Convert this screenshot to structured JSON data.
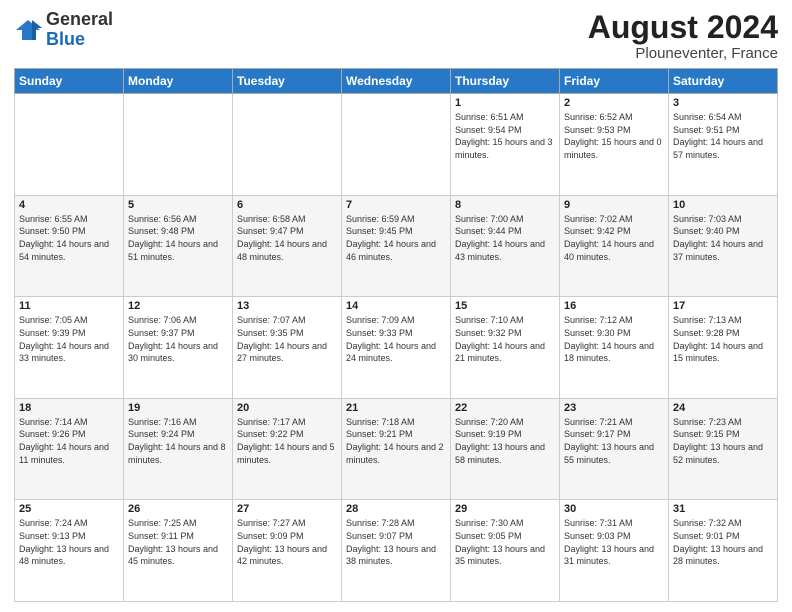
{
  "logo": {
    "general": "General",
    "blue": "Blue"
  },
  "header": {
    "title": "August 2024",
    "subtitle": "Plouneventer, France"
  },
  "weekdays": [
    "Sunday",
    "Monday",
    "Tuesday",
    "Wednesday",
    "Thursday",
    "Friday",
    "Saturday"
  ],
  "weeks": [
    [
      {
        "day": "",
        "sunrise": "",
        "sunset": "",
        "daylight": ""
      },
      {
        "day": "",
        "sunrise": "",
        "sunset": "",
        "daylight": ""
      },
      {
        "day": "",
        "sunrise": "",
        "sunset": "",
        "daylight": ""
      },
      {
        "day": "",
        "sunrise": "",
        "sunset": "",
        "daylight": ""
      },
      {
        "day": "1",
        "sunrise": "6:51 AM",
        "sunset": "9:54 PM",
        "daylight": "15 hours and 3 minutes."
      },
      {
        "day": "2",
        "sunrise": "6:52 AM",
        "sunset": "9:53 PM",
        "daylight": "15 hours and 0 minutes."
      },
      {
        "day": "3",
        "sunrise": "6:54 AM",
        "sunset": "9:51 PM",
        "daylight": "14 hours and 57 minutes."
      }
    ],
    [
      {
        "day": "4",
        "sunrise": "6:55 AM",
        "sunset": "9:50 PM",
        "daylight": "14 hours and 54 minutes."
      },
      {
        "day": "5",
        "sunrise": "6:56 AM",
        "sunset": "9:48 PM",
        "daylight": "14 hours and 51 minutes."
      },
      {
        "day": "6",
        "sunrise": "6:58 AM",
        "sunset": "9:47 PM",
        "daylight": "14 hours and 48 minutes."
      },
      {
        "day": "7",
        "sunrise": "6:59 AM",
        "sunset": "9:45 PM",
        "daylight": "14 hours and 46 minutes."
      },
      {
        "day": "8",
        "sunrise": "7:00 AM",
        "sunset": "9:44 PM",
        "daylight": "14 hours and 43 minutes."
      },
      {
        "day": "9",
        "sunrise": "7:02 AM",
        "sunset": "9:42 PM",
        "daylight": "14 hours and 40 minutes."
      },
      {
        "day": "10",
        "sunrise": "7:03 AM",
        "sunset": "9:40 PM",
        "daylight": "14 hours and 37 minutes."
      }
    ],
    [
      {
        "day": "11",
        "sunrise": "7:05 AM",
        "sunset": "9:39 PM",
        "daylight": "14 hours and 33 minutes."
      },
      {
        "day": "12",
        "sunrise": "7:06 AM",
        "sunset": "9:37 PM",
        "daylight": "14 hours and 30 minutes."
      },
      {
        "day": "13",
        "sunrise": "7:07 AM",
        "sunset": "9:35 PM",
        "daylight": "14 hours and 27 minutes."
      },
      {
        "day": "14",
        "sunrise": "7:09 AM",
        "sunset": "9:33 PM",
        "daylight": "14 hours and 24 minutes."
      },
      {
        "day": "15",
        "sunrise": "7:10 AM",
        "sunset": "9:32 PM",
        "daylight": "14 hours and 21 minutes."
      },
      {
        "day": "16",
        "sunrise": "7:12 AM",
        "sunset": "9:30 PM",
        "daylight": "14 hours and 18 minutes."
      },
      {
        "day": "17",
        "sunrise": "7:13 AM",
        "sunset": "9:28 PM",
        "daylight": "14 hours and 15 minutes."
      }
    ],
    [
      {
        "day": "18",
        "sunrise": "7:14 AM",
        "sunset": "9:26 PM",
        "daylight": "14 hours and 11 minutes."
      },
      {
        "day": "19",
        "sunrise": "7:16 AM",
        "sunset": "9:24 PM",
        "daylight": "14 hours and 8 minutes."
      },
      {
        "day": "20",
        "sunrise": "7:17 AM",
        "sunset": "9:22 PM",
        "daylight": "14 hours and 5 minutes."
      },
      {
        "day": "21",
        "sunrise": "7:18 AM",
        "sunset": "9:21 PM",
        "daylight": "14 hours and 2 minutes."
      },
      {
        "day": "22",
        "sunrise": "7:20 AM",
        "sunset": "9:19 PM",
        "daylight": "13 hours and 58 minutes."
      },
      {
        "day": "23",
        "sunrise": "7:21 AM",
        "sunset": "9:17 PM",
        "daylight": "13 hours and 55 minutes."
      },
      {
        "day": "24",
        "sunrise": "7:23 AM",
        "sunset": "9:15 PM",
        "daylight": "13 hours and 52 minutes."
      }
    ],
    [
      {
        "day": "25",
        "sunrise": "7:24 AM",
        "sunset": "9:13 PM",
        "daylight": "13 hours and 48 minutes."
      },
      {
        "day": "26",
        "sunrise": "7:25 AM",
        "sunset": "9:11 PM",
        "daylight": "13 hours and 45 minutes."
      },
      {
        "day": "27",
        "sunrise": "7:27 AM",
        "sunset": "9:09 PM",
        "daylight": "13 hours and 42 minutes."
      },
      {
        "day": "28",
        "sunrise": "7:28 AM",
        "sunset": "9:07 PM",
        "daylight": "13 hours and 38 minutes."
      },
      {
        "day": "29",
        "sunrise": "7:30 AM",
        "sunset": "9:05 PM",
        "daylight": "13 hours and 35 minutes."
      },
      {
        "day": "30",
        "sunrise": "7:31 AM",
        "sunset": "9:03 PM",
        "daylight": "13 hours and 31 minutes."
      },
      {
        "day": "31",
        "sunrise": "7:32 AM",
        "sunset": "9:01 PM",
        "daylight": "13 hours and 28 minutes."
      }
    ]
  ],
  "labels": {
    "sunrise": "Sunrise:",
    "sunset": "Sunset:",
    "daylight": "Daylight:"
  }
}
